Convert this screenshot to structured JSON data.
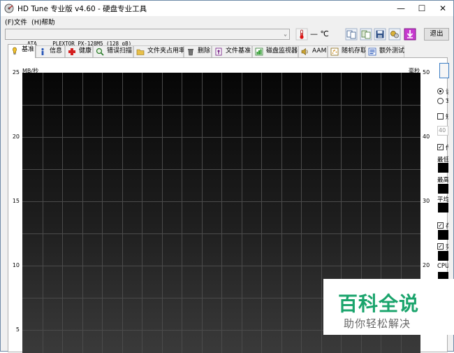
{
  "window": {
    "title": "HD Tune 专业版 v4.60 - 硬盘专业工具",
    "controls": {
      "minimize": "—",
      "maximize": "☐",
      "close": "✕"
    }
  },
  "menu": [
    {
      "label": "(F)文件"
    },
    {
      "label": "(H)帮助"
    }
  ],
  "toolbar": {
    "drive": "ATA     PLEXTOR PX-128M5 (128 gB)",
    "temperature": "— ℃",
    "exit_label": "退出",
    "icons": [
      "thermometer-icon",
      "copy-text-icon",
      "copy-screenshot-icon",
      "save-icon",
      "options-icon",
      "download-icon"
    ]
  },
  "tabs": [
    {
      "label": "基准",
      "icon": "benchmark-icon",
      "active": true
    },
    {
      "label": "信息",
      "icon": "info-icon"
    },
    {
      "label": "健康",
      "icon": "health-icon"
    },
    {
      "label": "错误扫描",
      "icon": "error-scan-icon"
    },
    {
      "label": "文件夹占用率",
      "icon": "folder-usage-icon"
    },
    {
      "label": "删除",
      "icon": "erase-icon"
    },
    {
      "label": "文件基准",
      "icon": "file-benchmark-icon"
    },
    {
      "label": "磁盘监视器",
      "icon": "disk-monitor-icon"
    },
    {
      "label": "AAM",
      "icon": "aam-icon"
    },
    {
      "label": "随机存取",
      "icon": "random-access-icon"
    },
    {
      "label": "额外测试",
      "icon": "extra-tests-icon"
    }
  ],
  "chart": {
    "left_unit": "MB/秒",
    "right_unit": "毫秒",
    "left_ticks": [
      "25",
      "20",
      "15",
      "10",
      "5"
    ],
    "right_ticks": [
      "50",
      "40",
      "30",
      "20"
    ],
    "left_range": [
      0,
      25
    ],
    "right_range": [
      0,
      50
    ],
    "grid": true,
    "vertical_divisions": 20,
    "horizontal_divisions": 20,
    "background": "#0a0a0a",
    "grid_color": "#4b4b4b"
  },
  "side_panel": {
    "radio_1": "读",
    "radio_2": "写",
    "short_stroke_label": "短",
    "short_stroke_value": "40",
    "transfer_rate_label": "传",
    "min_label": "最低",
    "max_label": "最高",
    "avg_label": "平均",
    "access_time_label": "存",
    "burst_rate_label": "突",
    "cpu_label": "CPU"
  },
  "watermark": {
    "title": "百科全说",
    "subtitle": "助你轻松解决"
  }
}
